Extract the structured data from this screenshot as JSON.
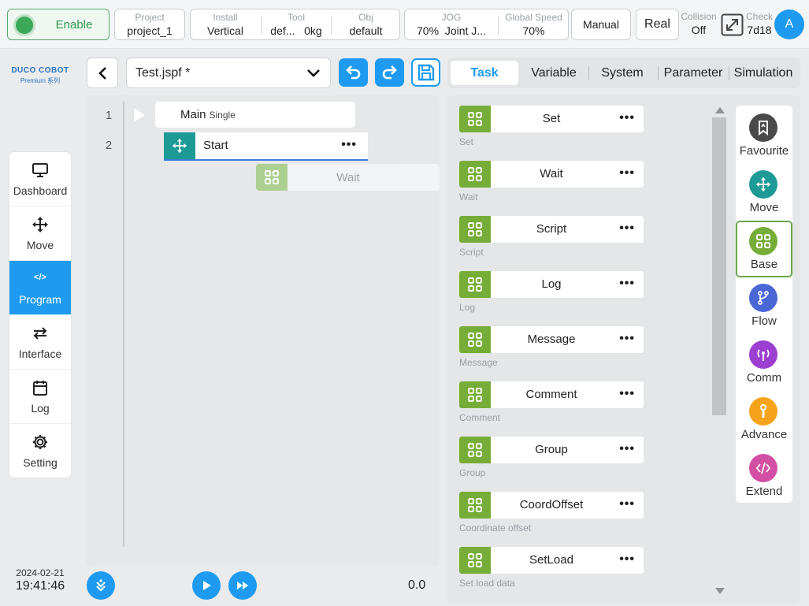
{
  "topbar": {
    "enable_label": "Enable",
    "project": {
      "caption": "Project",
      "value": "project_1"
    },
    "install": {
      "caption": "Install",
      "value": "Vertical"
    },
    "tool": {
      "caption": "Tool",
      "name": "def...",
      "load": "0kg"
    },
    "obj": {
      "caption": "Obj",
      "value": "default"
    },
    "jog": {
      "caption": "JOG",
      "percent": "70%",
      "mode": "Joint J..."
    },
    "global_speed": {
      "caption": "Global Speed",
      "value": "70%"
    },
    "mode_button": "Manual",
    "real_button": "Real",
    "collision": {
      "caption": "Collision",
      "value": "Off"
    },
    "check": {
      "caption": "Check",
      "value": "7d18"
    },
    "avatar_letter": "A"
  },
  "brand": {
    "name": "DUCO COBOT",
    "series": "Premium 系列"
  },
  "nav": {
    "items": [
      {
        "label": "Dashboard",
        "icon": "monitor-icon"
      },
      {
        "label": "Move",
        "icon": "move-arrows-icon"
      },
      {
        "label": "Program",
        "icon": "code-icon",
        "active": true
      },
      {
        "label": "Interface",
        "icon": "swap-icon"
      },
      {
        "label": "Log",
        "icon": "calendar-icon"
      },
      {
        "label": "Setting",
        "icon": "gear-icon"
      }
    ],
    "program_glyph": "</>"
  },
  "clock": {
    "date": "2024-02-21",
    "time": "19:41:46"
  },
  "editor": {
    "file_name": "Test.jspf *",
    "line_numbers": [
      "1",
      "2"
    ],
    "main_node": {
      "label": "Main",
      "sub": "Single"
    },
    "start_node": {
      "label": "Start"
    },
    "dragging_node": {
      "label": "Wait"
    },
    "speed_readout": "0.0"
  },
  "tabs": [
    "Task",
    "Variable",
    "System",
    "Parameter",
    "Simulation"
  ],
  "commands": [
    {
      "name": "Set",
      "desc": "Set"
    },
    {
      "name": "Wait",
      "desc": "Wait"
    },
    {
      "name": "Script",
      "desc": "Script"
    },
    {
      "name": "Log",
      "desc": "Log"
    },
    {
      "name": "Message",
      "desc": "Message"
    },
    {
      "name": "Comment",
      "desc": "Comment"
    },
    {
      "name": "Group",
      "desc": "Group"
    },
    {
      "name": "CoordOffset",
      "desc": "Coordinate offset"
    },
    {
      "name": "SetLoad",
      "desc": "Set load data"
    }
  ],
  "categories": [
    {
      "label": "Favourite",
      "color": "#4a4a4a",
      "icon": "bookmark-icon"
    },
    {
      "label": "Move",
      "color": "#1e9a96",
      "icon": "move-arrows-icon"
    },
    {
      "label": "Base",
      "color": "#76ad38",
      "icon": "grid-icon",
      "active": true
    },
    {
      "label": "Flow",
      "color": "#4a67d6",
      "icon": "branch-icon"
    },
    {
      "label": "Comm",
      "color": "#9c3fd0",
      "icon": "antenna-icon"
    },
    {
      "label": "Advance",
      "color": "#f5a31a",
      "icon": "wrench-icon"
    },
    {
      "label": "Extend",
      "color": "#d24fa3",
      "icon": "code-icon"
    }
  ],
  "colors": {
    "accent": "#1e9bf0",
    "enable_green": "#3ca85a",
    "base_green": "#76ad38",
    "move_teal": "#1e9a96"
  }
}
